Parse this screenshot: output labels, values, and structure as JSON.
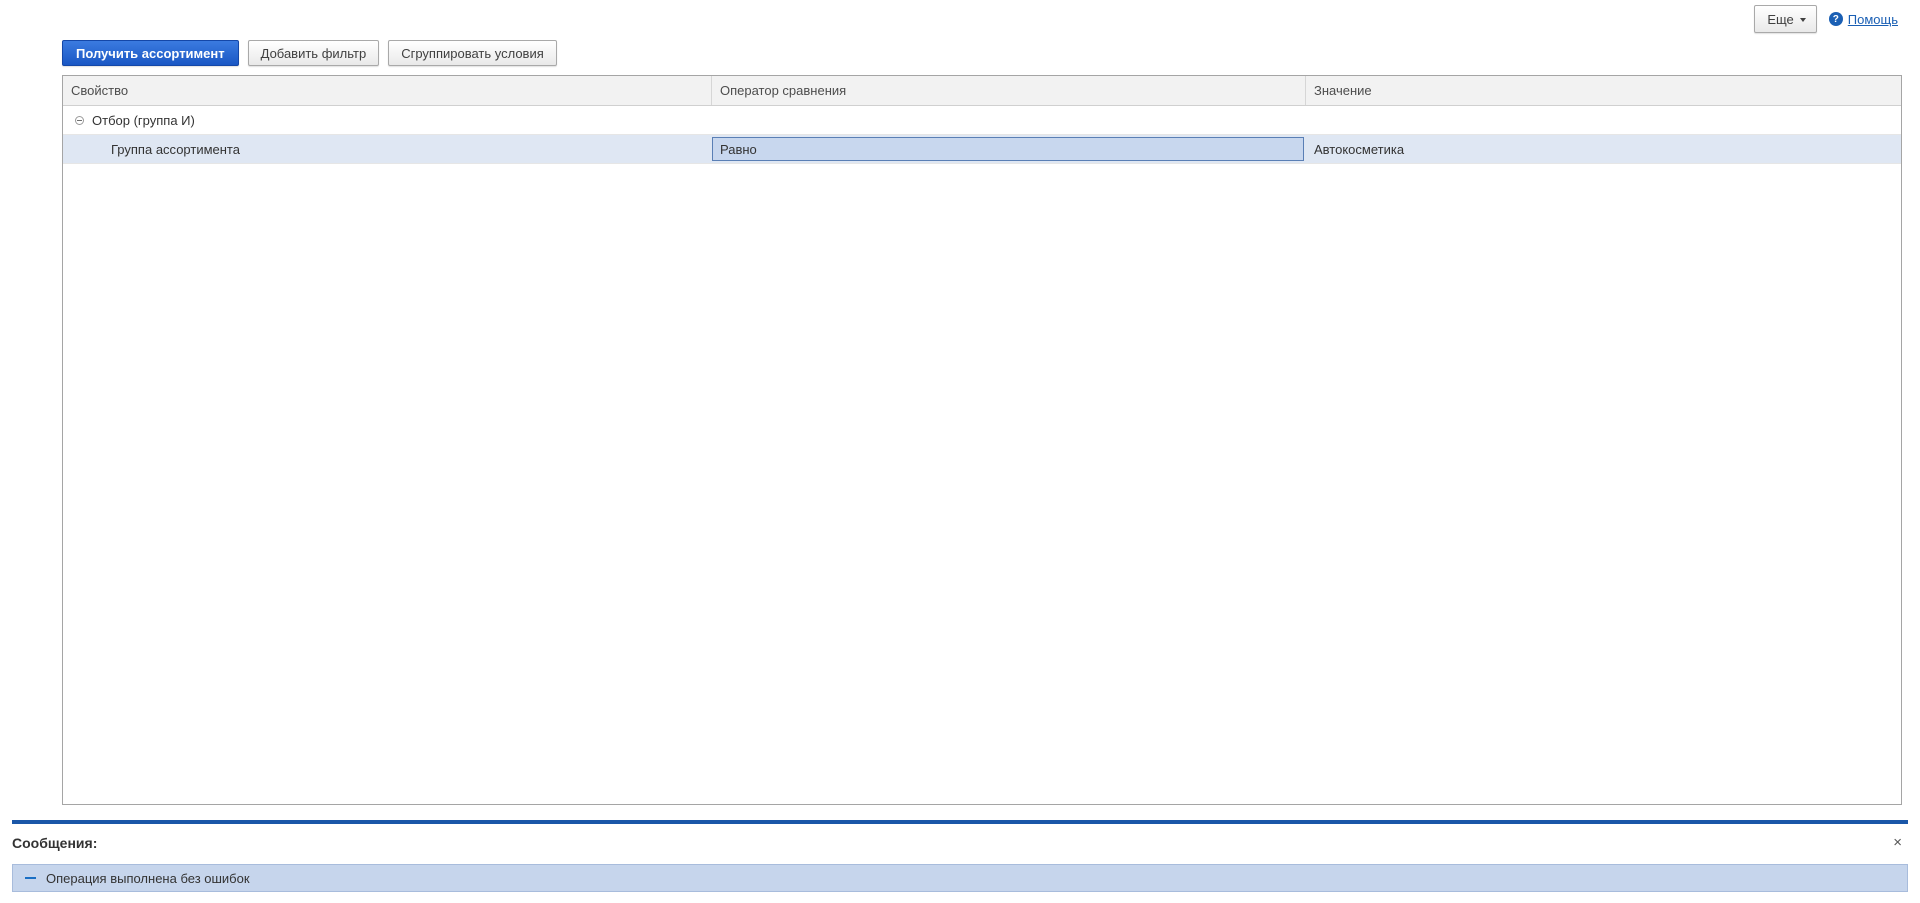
{
  "header": {
    "more_label": "Еще",
    "help_label": "Помощь"
  },
  "toolbar": {
    "get_assortment_label": "Получить ассортимент",
    "add_filter_label": "Добавить фильтр",
    "group_conditions_label": "Сгруппировать условия"
  },
  "grid": {
    "columns": [
      "Свойство",
      "Оператор сравнения",
      "Значение"
    ],
    "group_row": {
      "label": "Отбор (группа И)"
    },
    "rows": [
      {
        "property": "Группа ассортимента",
        "operator": "Равно",
        "value": "Автокосметика"
      }
    ]
  },
  "messages": {
    "title": "Сообщения:",
    "items": [
      "Операция выполнена без ошибок"
    ]
  },
  "colors": {
    "primary": "#1a57c4",
    "selection": "#dfe7f3",
    "message_bg": "#c6d5ec",
    "messages_bar": "#1a57a8"
  }
}
